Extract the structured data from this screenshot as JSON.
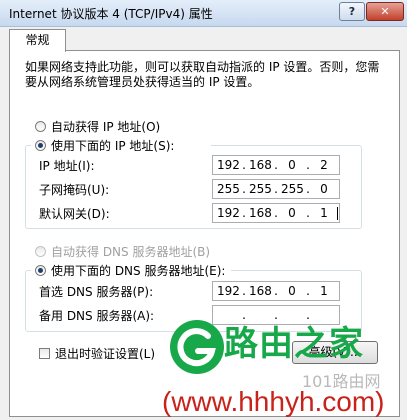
{
  "window": {
    "title": "Internet 协议版本 4 (TCP/IPv4) 属性",
    "help_label": "?",
    "close_label": "✕"
  },
  "tabs": [
    {
      "label": "常规"
    }
  ],
  "description": "如果网络支持此功能，则可以获取自动指派的 IP 设置。否则，您需要从网络系统管理员处获得适当的 IP 设置。",
  "ip_section": {
    "auto_label": "自动获得 IP 地址(O)",
    "manual_label": "使用下面的 IP 地址(S):",
    "selected": "manual",
    "fields": [
      {
        "label": "IP 地址(I):",
        "octets": [
          "192",
          "168",
          "0",
          "2"
        ]
      },
      {
        "label": "子网掩码(U):",
        "octets": [
          "255",
          "255",
          "255",
          "0"
        ]
      },
      {
        "label": "默认网关(D):",
        "octets": [
          "192",
          "168",
          "0",
          "1"
        ]
      }
    ]
  },
  "dns_section": {
    "auto_label": "自动获得 DNS 服务器地址(B)",
    "manual_label": "使用下面的 DNS 服务器地址(E):",
    "selected": "manual",
    "fields": [
      {
        "label": "首选 DNS 服务器(P):",
        "octets": [
          "192",
          "168",
          "0",
          "1"
        ]
      },
      {
        "label": "备用 DNS 服务器(A):",
        "octets": [
          "",
          "",
          "",
          ""
        ]
      }
    ]
  },
  "validate_label": "退出时验证设置(L)",
  "advanced_label": "高级(V)...",
  "watermark": {
    "name": "路由之家",
    "sub": "101路由网",
    "url": "(www.hhhyh.com)"
  },
  "colors": {
    "watermark_green": "#17a84a",
    "watermark_red": "#c8221a",
    "selected_radio": "#1e3f6e"
  }
}
